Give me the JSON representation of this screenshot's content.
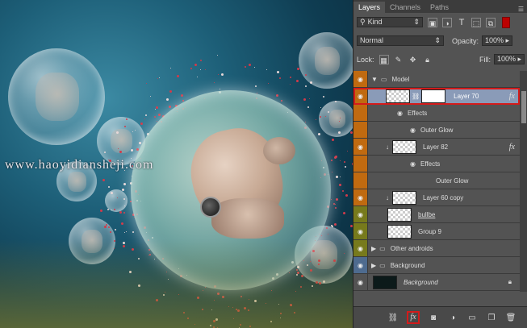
{
  "watermark": "www.haoyidiansheji.com",
  "panel": {
    "tabs": [
      {
        "label": "Layers",
        "active": true
      },
      {
        "label": "Channels",
        "active": false
      },
      {
        "label": "Paths",
        "active": false
      }
    ],
    "filter_kind": "Kind",
    "blend_mode": "Normal",
    "opacity_label": "Opacity:",
    "opacity_value": "100%",
    "lock_label": "Lock:",
    "fill_label": "Fill:",
    "fill_value": "100%"
  },
  "layers": [
    {
      "name": "Model",
      "type": "group",
      "expanded": true,
      "tag_color": "orange"
    },
    {
      "name": "Layer 70",
      "type": "layer",
      "selected": true,
      "fx": true,
      "tag_color": "orange"
    },
    {
      "name": "Effects",
      "type": "effects-header",
      "tag_color": "orange"
    },
    {
      "name": "Outer Glow",
      "type": "effect",
      "tag_color": "orange"
    },
    {
      "name": "Layer 82",
      "type": "layer",
      "fx": true,
      "clipped": true,
      "tag_color": "orange"
    },
    {
      "name": "Effects",
      "type": "effects-header",
      "tag_color": "orange"
    },
    {
      "name": "Outer Glow",
      "type": "effect",
      "tag_color": "orange"
    },
    {
      "name": "Layer 60 copy",
      "type": "layer",
      "clipped": true,
      "tag_color": "orange"
    },
    {
      "name": "bullbe",
      "type": "layer",
      "tag_color": "olive"
    },
    {
      "name": "Group 9",
      "type": "layer",
      "tag_color": "olive"
    },
    {
      "name": "Other androids",
      "type": "group",
      "expanded": false,
      "tag_color": "olive"
    },
    {
      "name": "Background",
      "type": "group",
      "expanded": false,
      "tag_color": "blue"
    },
    {
      "name": "Background",
      "type": "background",
      "locked": true,
      "tag_color": "none"
    }
  ],
  "toolbar": {
    "icons": [
      "link-icon",
      "fx-icon",
      "mask-icon",
      "adjustment-icon",
      "folder-icon",
      "new-layer-icon",
      "trash-icon"
    ],
    "fx_label": "fx"
  },
  "colors": {
    "highlight": "#d41b1b",
    "orange_tag": "#c06a10",
    "olive_tag": "#777a1c",
    "blue_tag": "#4e6b8f",
    "panel_bg": "#535353",
    "selected_row": "#8a9bb8"
  }
}
